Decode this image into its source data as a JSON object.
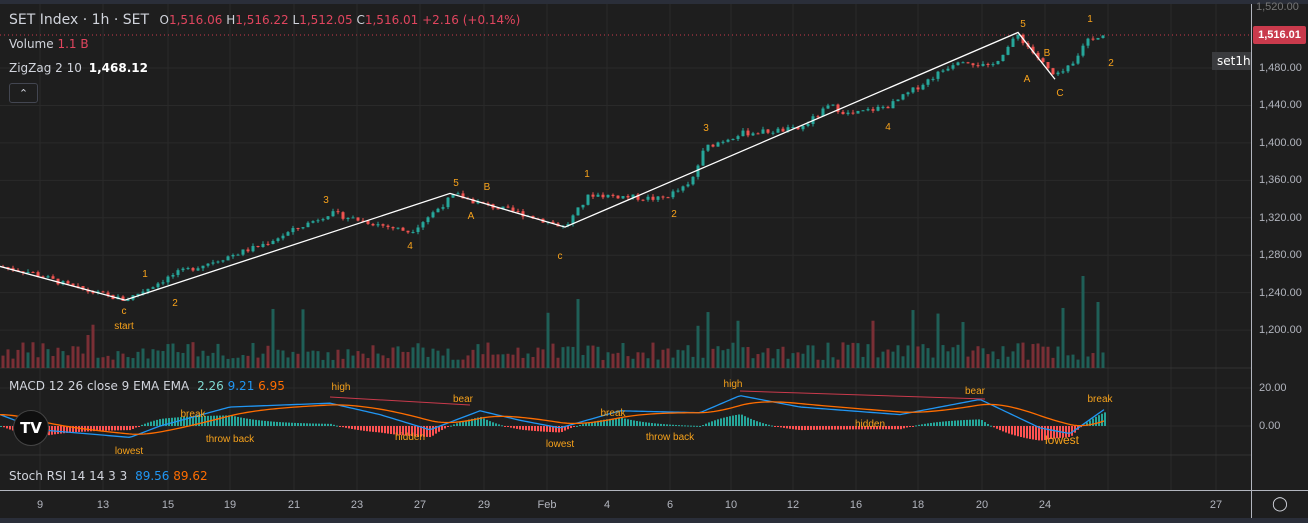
{
  "header": {
    "symbol": "SET Index · 1h · SET",
    "o_label": "O",
    "open": "1,516.06",
    "h_label": "H",
    "high": "1,516.22",
    "l_label": "L",
    "low": "1,512.05",
    "c_label": "C",
    "close": "1,516.01",
    "change": "+2.16 (+0.14%)"
  },
  "volume": {
    "label": "Volume",
    "value": "1.1 B"
  },
  "zigzag": {
    "label": "ZigZag 2 10",
    "value": "1,468.12",
    "pivots": [
      1268,
      1232,
      1346,
      1310,
      1516,
      1468
    ]
  },
  "collapse_icon": "chevron-up-icon",
  "macd": {
    "label": "MACD 12 26 close 9 EMA EMA",
    "hist": "2.26",
    "macd": "9.21",
    "signal": "6.95"
  },
  "stoch": {
    "label": "Stoch RSI 14 14 3 3",
    "k": "89.56",
    "d": "89.62"
  },
  "price_axis": [
    "1,480.00",
    "1,440.00",
    "1,400.00",
    "1,360.00",
    "1,320.00",
    "1,280.00",
    "1,240.00",
    "1,200.00"
  ],
  "macd_axis": [
    "20.00",
    "0.00"
  ],
  "last_price": "1,516.01",
  "last_price_partial": "1,520.00",
  "symbol_tag": "set1h",
  "time_axis": [
    "9",
    "13",
    "15",
    "19",
    "21",
    "23",
    "27",
    "29",
    "Feb",
    "4",
    "6",
    "10",
    "12",
    "16",
    "18",
    "20",
    "24",
    "27"
  ],
  "wave_labels": [
    "1",
    "2",
    "c",
    "start",
    "3",
    "4",
    "5",
    "B",
    "A",
    "c",
    "1",
    "2",
    "3",
    "4",
    "5",
    "B",
    "A",
    "C",
    "1",
    "2"
  ],
  "macd_labels": [
    "high",
    "bear",
    "break",
    "throw back",
    "hidden",
    "lowest",
    "lowest",
    "break",
    "throw back",
    "high",
    "hidden",
    "bear",
    "lowest",
    "break"
  ],
  "colors": {
    "up": "#26a69a",
    "down": "#ef5350",
    "label": "#f7a21b",
    "macd": "#2196f3",
    "signal": "#ff6d00",
    "price_tag": "#c93a4c"
  },
  "settings_icon": "gear-icon",
  "logo_icon": "tradingview-logo-icon"
}
